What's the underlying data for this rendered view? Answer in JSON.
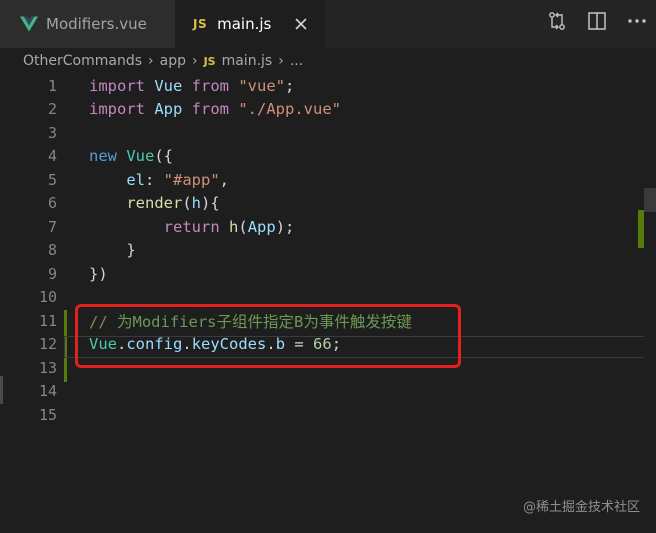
{
  "tabs": [
    {
      "label": "Modifiers.vue",
      "active": false
    },
    {
      "label": "main.js",
      "active": true
    }
  ],
  "tab_icons": {
    "js": "JS"
  },
  "breadcrumb": {
    "items": [
      "OtherCommands",
      "app",
      "main.js",
      "..."
    ],
    "js_icon": "JS"
  },
  "code": {
    "line_numbers": [
      "1",
      "2",
      "3",
      "4",
      "5",
      "6",
      "7",
      "8",
      "9",
      "10",
      "11",
      "12",
      "13",
      "14",
      "15"
    ],
    "l1": {
      "a": "import",
      "b": " Vue ",
      "c": "from",
      "d": " ",
      "e": "\"vue\"",
      "f": ";"
    },
    "l2": {
      "a": "import",
      "b": " App ",
      "c": "from",
      "d": " ",
      "e": "\"./App.vue\""
    },
    "l4": {
      "a": "new",
      "b": " ",
      "c": "Vue",
      "d": "({"
    },
    "l5": {
      "a": "    el",
      "b": ": ",
      "c": "\"#app\"",
      "d": ","
    },
    "l6": {
      "a": "    render",
      "b": "(",
      "c": "h",
      "d": "){"
    },
    "l7": {
      "a": "        return",
      "b": " ",
      "c": "h",
      "d": "(",
      "e": "App",
      "f": ");"
    },
    "l8": {
      "a": "    }"
    },
    "l9": {
      "a": "})"
    },
    "l11": {
      "a": "// 为Modifiers子组件指定B为事件触发按键"
    },
    "l12": {
      "a": "Vue",
      "b": ".",
      "c": "config",
      "d": ".",
      "e": "keyCodes",
      "f": ".",
      "g": "b",
      "h": " = ",
      "i": "66",
      "j": ";"
    }
  },
  "watermark": "@稀土掘金技术社区",
  "colors": {
    "highlight_border": "#e0211e",
    "git_modified": "#587c0c"
  }
}
